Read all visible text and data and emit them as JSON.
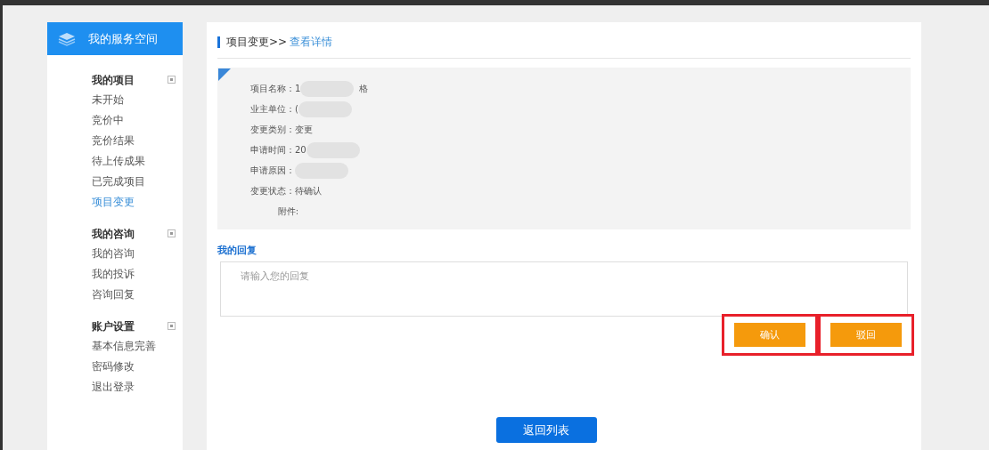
{
  "sidebar": {
    "title": "我的服务空间",
    "groups": [
      {
        "title": "我的项目",
        "items": [
          {
            "label": "未开始",
            "selected": false
          },
          {
            "label": "竞价中",
            "selected": false
          },
          {
            "label": "竞价结果",
            "selected": false
          },
          {
            "label": "待上传成果",
            "selected": false
          },
          {
            "label": "已完成项目",
            "selected": false
          },
          {
            "label": "项目变更",
            "selected": true
          }
        ]
      },
      {
        "title": "我的咨询",
        "items": [
          {
            "label": "我的咨询",
            "selected": false
          },
          {
            "label": "我的投诉",
            "selected": false
          },
          {
            "label": "咨询回复",
            "selected": false
          }
        ]
      },
      {
        "title": "账户设置",
        "items": [
          {
            "label": "基本信息完善",
            "selected": false
          },
          {
            "label": "密码修改",
            "selected": false
          },
          {
            "label": "退出登录",
            "selected": false
          }
        ]
      }
    ]
  },
  "breadcrumb": {
    "parent": "项目变更>>",
    "current": "查看详情"
  },
  "details": [
    {
      "label": "项目名称：",
      "value": "1",
      "redacted": true,
      "suffix": "格"
    },
    {
      "label": "业主单位：",
      "value": "(",
      "redacted": true
    },
    {
      "label": "变更类别：",
      "value": "变更",
      "redacted": false
    },
    {
      "label": "申请时间：",
      "value": "20",
      "redacted": true
    },
    {
      "label": "申请原因：",
      "redacted": true
    },
    {
      "label": "变更状态：",
      "value": "待确认",
      "redacted": false
    },
    {
      "label": "附件:",
      "redacted": false
    }
  ],
  "reply": {
    "title": "我的回复",
    "placeholder": "请输入您的回复"
  },
  "actions": [
    {
      "label": "确认",
      "highlighted": true
    },
    {
      "label": "驳回",
      "highlighted": true
    }
  ],
  "back_button": "返回列表"
}
